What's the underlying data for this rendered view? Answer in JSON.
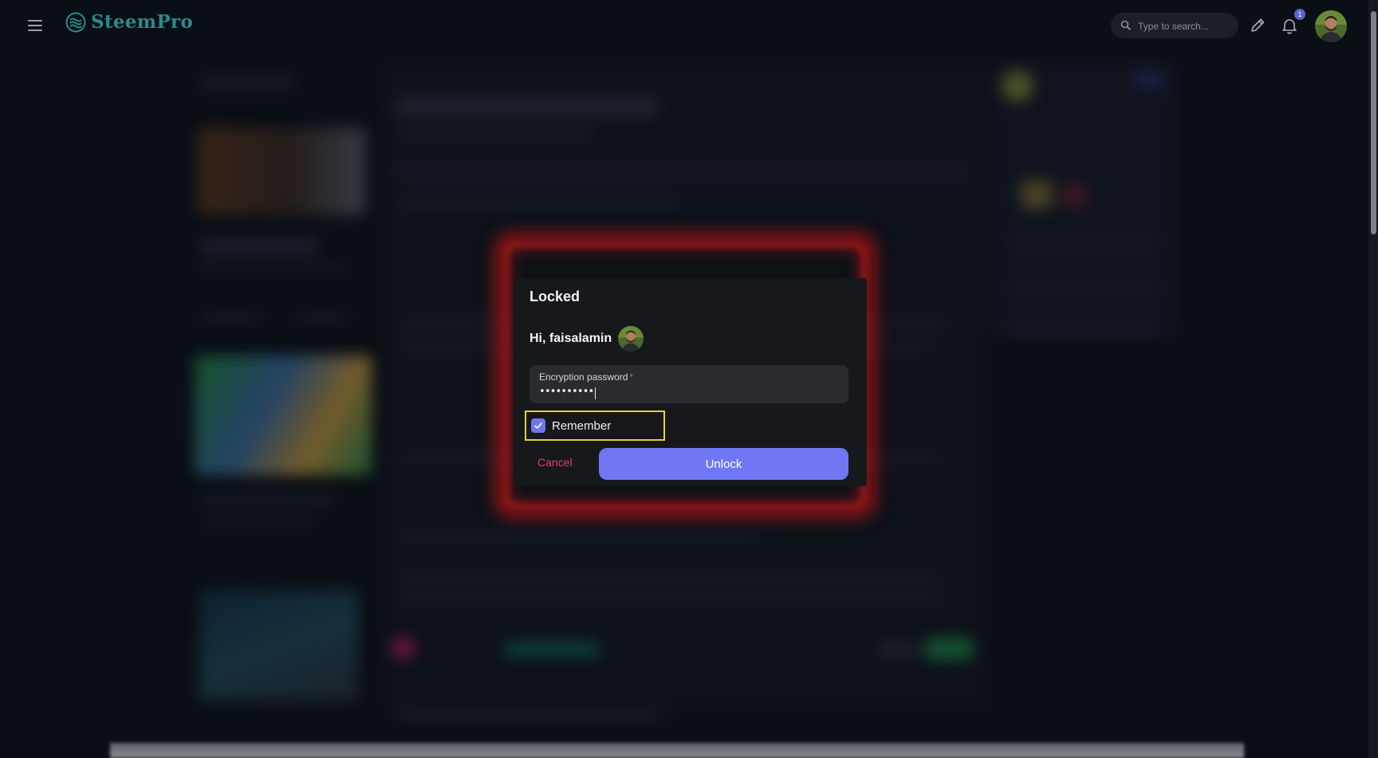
{
  "app": {
    "name": "SteemPro"
  },
  "header": {
    "search_placeholder": "Type to search...",
    "notification_count": "1",
    "icons": [
      "menu-icon",
      "steempro-logo-icon",
      "search-icon",
      "pen-icon",
      "bell-icon"
    ]
  },
  "modal": {
    "title": "Locked",
    "greeting": "Hi, faisalamin",
    "password_label": "Encryption password",
    "password_required_mark": "*",
    "password_value": "••••••••••",
    "remember_label": "Remember",
    "remember_checked": true,
    "cancel_label": "Cancel",
    "unlock_label": "Unlock"
  },
  "colors": {
    "background": "#0a0e15",
    "modal_bg": "#17181b",
    "field_bg": "#2a2b2f",
    "accent": "#6f78f2",
    "cancel": "#d8456a",
    "highlight_border": "#e2d23a",
    "logo": "#2c8a8c",
    "glow": "#aa1414"
  }
}
